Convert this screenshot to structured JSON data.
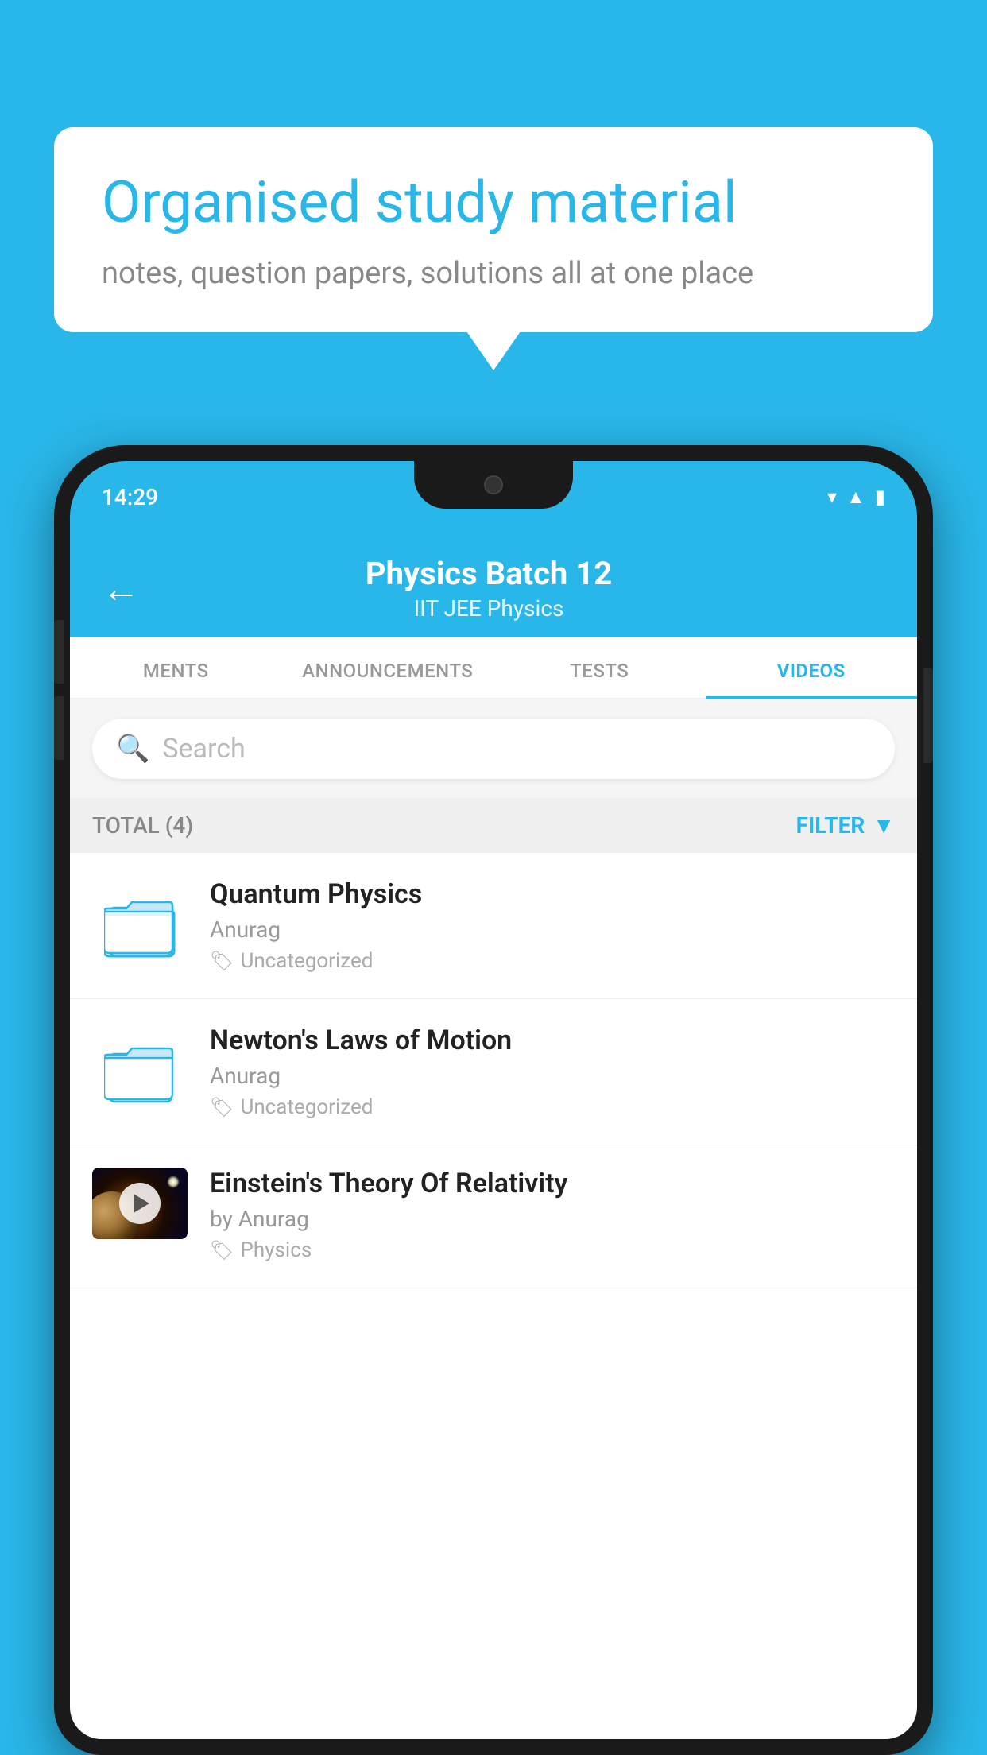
{
  "background": {
    "color": "#29B6E8"
  },
  "speech_bubble": {
    "title": "Organised study material",
    "subtitle": "notes, question papers, solutions all at one place"
  },
  "phone": {
    "status_bar": {
      "time": "14:29"
    },
    "header": {
      "title": "Physics Batch 12",
      "subtitle": "IIT JEE   Physics",
      "back_label": "←"
    },
    "tabs": [
      {
        "label": "MENTS",
        "active": false
      },
      {
        "label": "ANNOUNCEMENTS",
        "active": false
      },
      {
        "label": "TESTS",
        "active": false
      },
      {
        "label": "VIDEOS",
        "active": true
      }
    ],
    "search": {
      "placeholder": "Search"
    },
    "filter_bar": {
      "total_label": "TOTAL (4)",
      "filter_label": "FILTER"
    },
    "videos": [
      {
        "title": "Quantum Physics",
        "author": "Anurag",
        "tag": "Uncategorized",
        "has_thumbnail": false
      },
      {
        "title": "Newton's Laws of Motion",
        "author": "Anurag",
        "tag": "Uncategorized",
        "has_thumbnail": false
      },
      {
        "title": "Einstein's Theory Of Relativity",
        "author": "by Anurag",
        "tag": "Physics",
        "has_thumbnail": true
      }
    ]
  }
}
